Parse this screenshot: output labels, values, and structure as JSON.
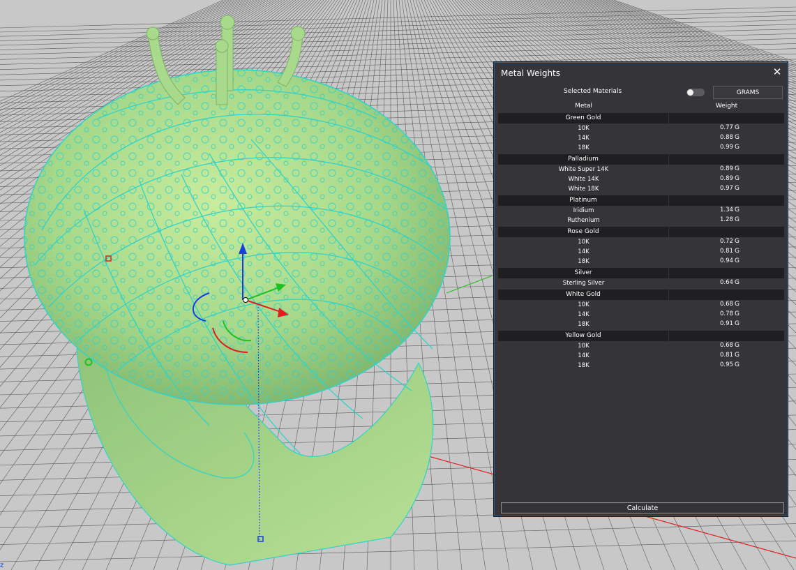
{
  "panel": {
    "title": "Metal Weights",
    "close": "✕",
    "selected_materials_label": "Selected Materials",
    "units_button": "GRAMS",
    "columns": {
      "metal": "Metal",
      "weight": "Weight"
    },
    "unit": "G",
    "groups": [
      {
        "name": "Green Gold",
        "items": [
          {
            "metal": "10K",
            "weight": "0.77"
          },
          {
            "metal": "14K",
            "weight": "0.88"
          },
          {
            "metal": "18K",
            "weight": "0.99"
          }
        ]
      },
      {
        "name": "Palladium",
        "items": [
          {
            "metal": "White Super 14K",
            "weight": "0.89"
          },
          {
            "metal": "White 14K",
            "weight": "0.89"
          },
          {
            "metal": "White 18K",
            "weight": "0.97"
          }
        ]
      },
      {
        "name": "Platinum",
        "items": [
          {
            "metal": "Iridium",
            "weight": "1.34"
          },
          {
            "metal": "Ruthenium",
            "weight": "1.28"
          }
        ]
      },
      {
        "name": "Rose Gold",
        "items": [
          {
            "metal": "10K",
            "weight": "0.72"
          },
          {
            "metal": "14K",
            "weight": "0.81"
          },
          {
            "metal": "18K",
            "weight": "0.94"
          }
        ]
      },
      {
        "name": "Silver",
        "items": [
          {
            "metal": "Sterling Silver",
            "weight": "0.64"
          }
        ]
      },
      {
        "name": "White Gold",
        "items": [
          {
            "metal": "10K",
            "weight": "0.68"
          },
          {
            "metal": "14K",
            "weight": "0.78"
          },
          {
            "metal": "18K",
            "weight": "0.91"
          }
        ]
      },
      {
        "name": "Yellow Gold",
        "items": [
          {
            "metal": "10K",
            "weight": "0.68"
          },
          {
            "metal": "14K",
            "weight": "0.81"
          },
          {
            "metal": "18K",
            "weight": "0.95"
          }
        ]
      }
    ],
    "calculate_button": "Calculate"
  },
  "viewport": {
    "axis_label": "z",
    "colors": {
      "background": "#c8c8c8",
      "grid": "#5d5d5d",
      "model_fill": "#9fd48a",
      "wireframe": "#2fd3c8",
      "axis_x": "#e02020",
      "axis_y": "#20c020",
      "axis_z": "#1a3de0",
      "panel_bg": "#353539",
      "panel_border": "#2b5d8a"
    }
  }
}
